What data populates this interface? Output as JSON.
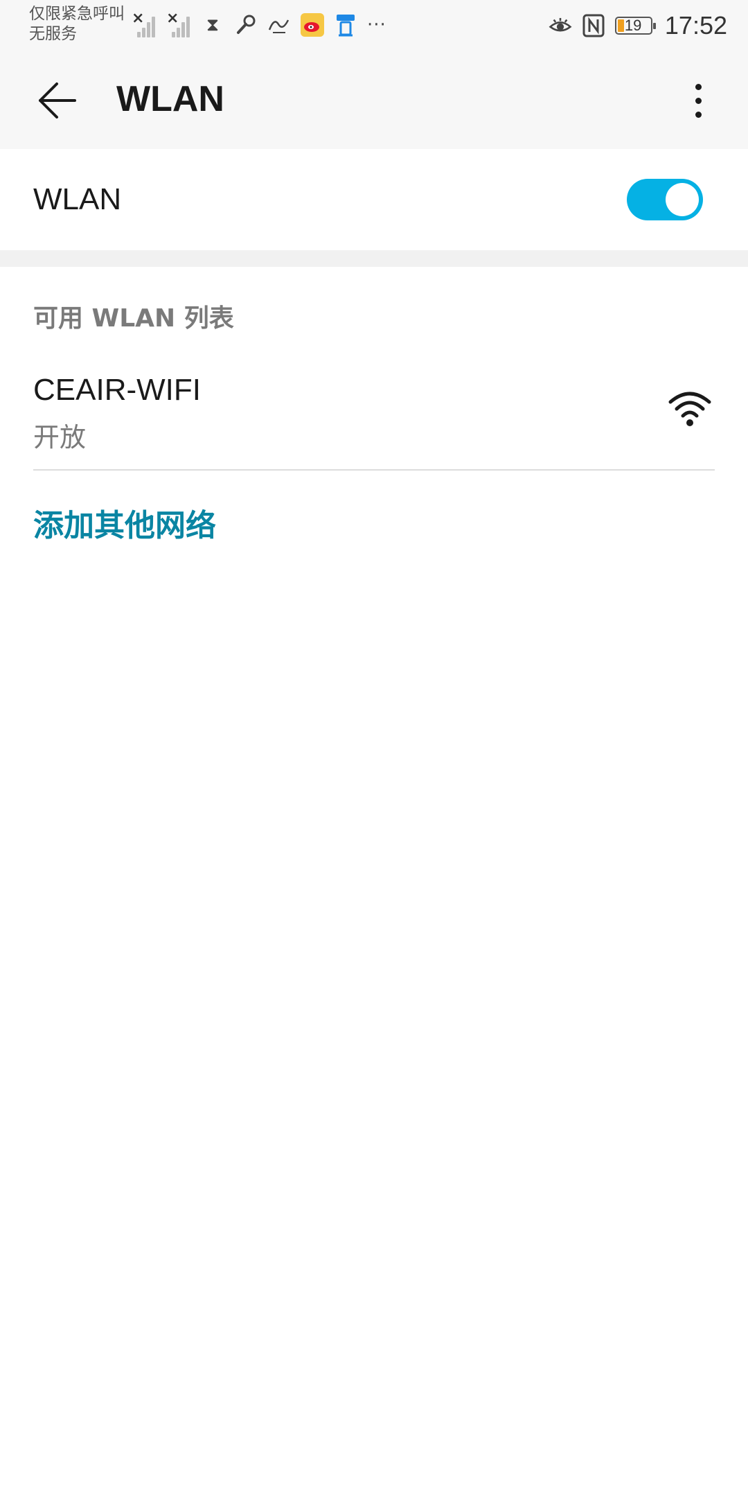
{
  "status_bar": {
    "carrier_line1": "仅限紧急呼叫",
    "carrier_line2": "无服务",
    "more_indicator": "···",
    "battery_level": "19",
    "time": "17:52",
    "icons_left": [
      "signal-1-no-service-icon",
      "signal-2-no-service-icon",
      "hourglass-icon",
      "key-icon",
      "xuexi-app-icon",
      "weibo-icon",
      "taobao-app-icon"
    ],
    "icons_right": [
      "eye-comfort-icon",
      "nfc-icon",
      "battery-icon"
    ]
  },
  "app_bar": {
    "title": "WLAN",
    "back_icon": "arrow-left-icon",
    "menu_icon": "more-vertical-icon"
  },
  "wlan_toggle": {
    "label": "WLAN",
    "enabled": true,
    "accent_color": "#05b1e4"
  },
  "available_networks": {
    "header": "可用 WLAN 列表",
    "items": [
      {
        "ssid": "CEAIR-WIFI",
        "security": "开放",
        "signal_icon": "wifi-full-icon"
      }
    ]
  },
  "add_network": {
    "label": "添加其他网络",
    "color": "#0a85a3"
  }
}
